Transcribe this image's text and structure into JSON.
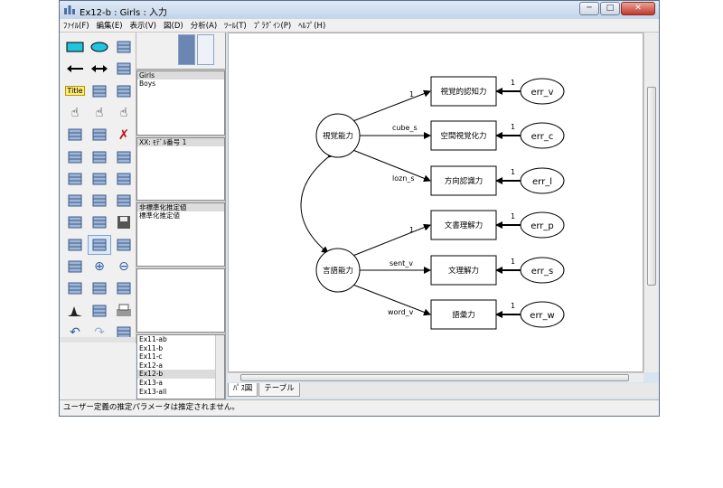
{
  "window": {
    "title": "Ex12-b : Girls : 入力",
    "minimize_glyph": "─",
    "maximize_glyph": "□",
    "close_glyph": "✕"
  },
  "menu": [
    "ﾌｧｲﾙ(F)",
    "編集(E)",
    "表示(V)",
    "図(D)",
    "分析(A)",
    "ﾂｰﾙ(T)",
    "ﾌﾟﾗｸﾞｲﾝ(P)",
    "ﾍﾙﾌﾟ(H)"
  ],
  "toolbox": {
    "title_tool_label": "Title",
    "icons": [
      "rectangle-tool-icon",
      "ellipse-tool-icon",
      "indicator-tool-icon",
      "single-arrow-tool-icon",
      "double-arrow-tool-icon",
      "unique-variable-tool-icon",
      "title-tool-icon",
      "list-variables-model-icon",
      "list-variables-dataset-icon",
      "select-one-hand-icon",
      "select-all-hand-icon",
      "deselect-all-hand-icon",
      "duplicate-truck-icon",
      "move-truck-icon",
      "erase-icon",
      "shape-change-icon",
      "rotate-icon",
      "reflect-icon",
      "move-parameter-icon",
      "scroll-icon",
      "touch-up-icon",
      "data-file-icon",
      "analysis-properties-icon",
      "calculate-estimates-icon",
      "copy-to-clipboard-icon",
      "text-output-icon",
      "save-diagram-icon",
      "object-properties-icon",
      "drag-properties-icon",
      "preserve-symmetry-icon",
      "zoom-in-area-icon",
      "zoom-in-icon",
      "zoom-out-icon",
      "zoom-page-icon",
      "fit-to-page-icon",
      "loupe-icon",
      "bayesian-icon",
      "multiple-group-icon",
      "print-icon",
      "undo-icon",
      "redo-icon",
      "specification-search-icon"
    ]
  },
  "groups": [
    "Girls",
    "Boys"
  ],
  "models": [
    "XX: ﾓﾃﾞﾙ番号 1"
  ],
  "parameter_formats": [
    "非標準化推定値",
    "標準化推定値"
  ],
  "files": [
    "Ex11-ab",
    "Ex11-b",
    "Ex11-c",
    "Ex12-a",
    "Ex12-b",
    "Ex13-a",
    "Ex13-all"
  ],
  "selected_file": "Ex12-b",
  "diagram": {
    "latent": [
      "視覚能力",
      "言語能力"
    ],
    "observed": [
      "視覚的認知力",
      "空間視覚化力",
      "方向認識力",
      "文書理解力",
      "文理解力",
      "語彙力"
    ],
    "errors": [
      "err_v",
      "err_c",
      "err_l",
      "err_p",
      "err_s",
      "err_w"
    ],
    "path_labels": [
      "1",
      "cube_s",
      "lozn_s",
      "1",
      "sent_v",
      "word_v"
    ],
    "error_loading": "1"
  },
  "tabs": [
    "ﾊﾟｽ図",
    "テーブル"
  ],
  "status": "ユーザー定義の推定パラメータは推定されません。"
}
